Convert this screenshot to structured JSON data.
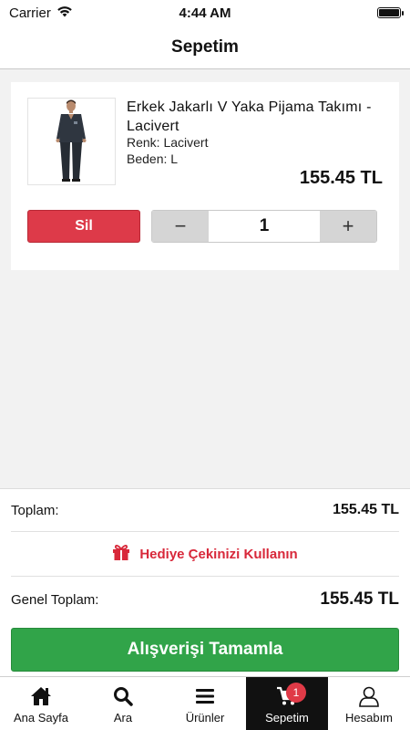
{
  "status_bar": {
    "carrier": "Carrier",
    "time": "4:44 AM"
  },
  "nav": {
    "title": "Sepetim"
  },
  "cart_item": {
    "name": "Erkek Jakarlı V Yaka Pijama Takımı - Lacivert",
    "color": "Renk: Lacivert",
    "size": "Beden: L",
    "price": "155.45 TL",
    "delete_label": "Sil",
    "minus_label": "−",
    "quantity": "1",
    "plus_label": "+"
  },
  "summary": {
    "total_label": "Toplam:",
    "total_value": "155.45 TL",
    "gift_label": "Hediye Çekinizi Kullanın",
    "grand_total_label": "Genel Toplam:",
    "grand_total_value": "155.45 TL",
    "checkout_label": "Alışverişi Tamamla"
  },
  "tabs": [
    {
      "label": "Ana Sayfa",
      "icon": "home-icon"
    },
    {
      "label": "Ara",
      "icon": "search-icon"
    },
    {
      "label": "Ürünler",
      "icon": "menu-icon"
    },
    {
      "label": "Sepetim",
      "icon": "cart-icon",
      "badge": "1"
    },
    {
      "label": "Hesabım",
      "icon": "user-icon"
    }
  ],
  "colors": {
    "delete": "#dd3a49",
    "checkout": "#31a449",
    "gift": "#d8283a",
    "active_tab": "#111111",
    "badge": "#e03a47"
  }
}
